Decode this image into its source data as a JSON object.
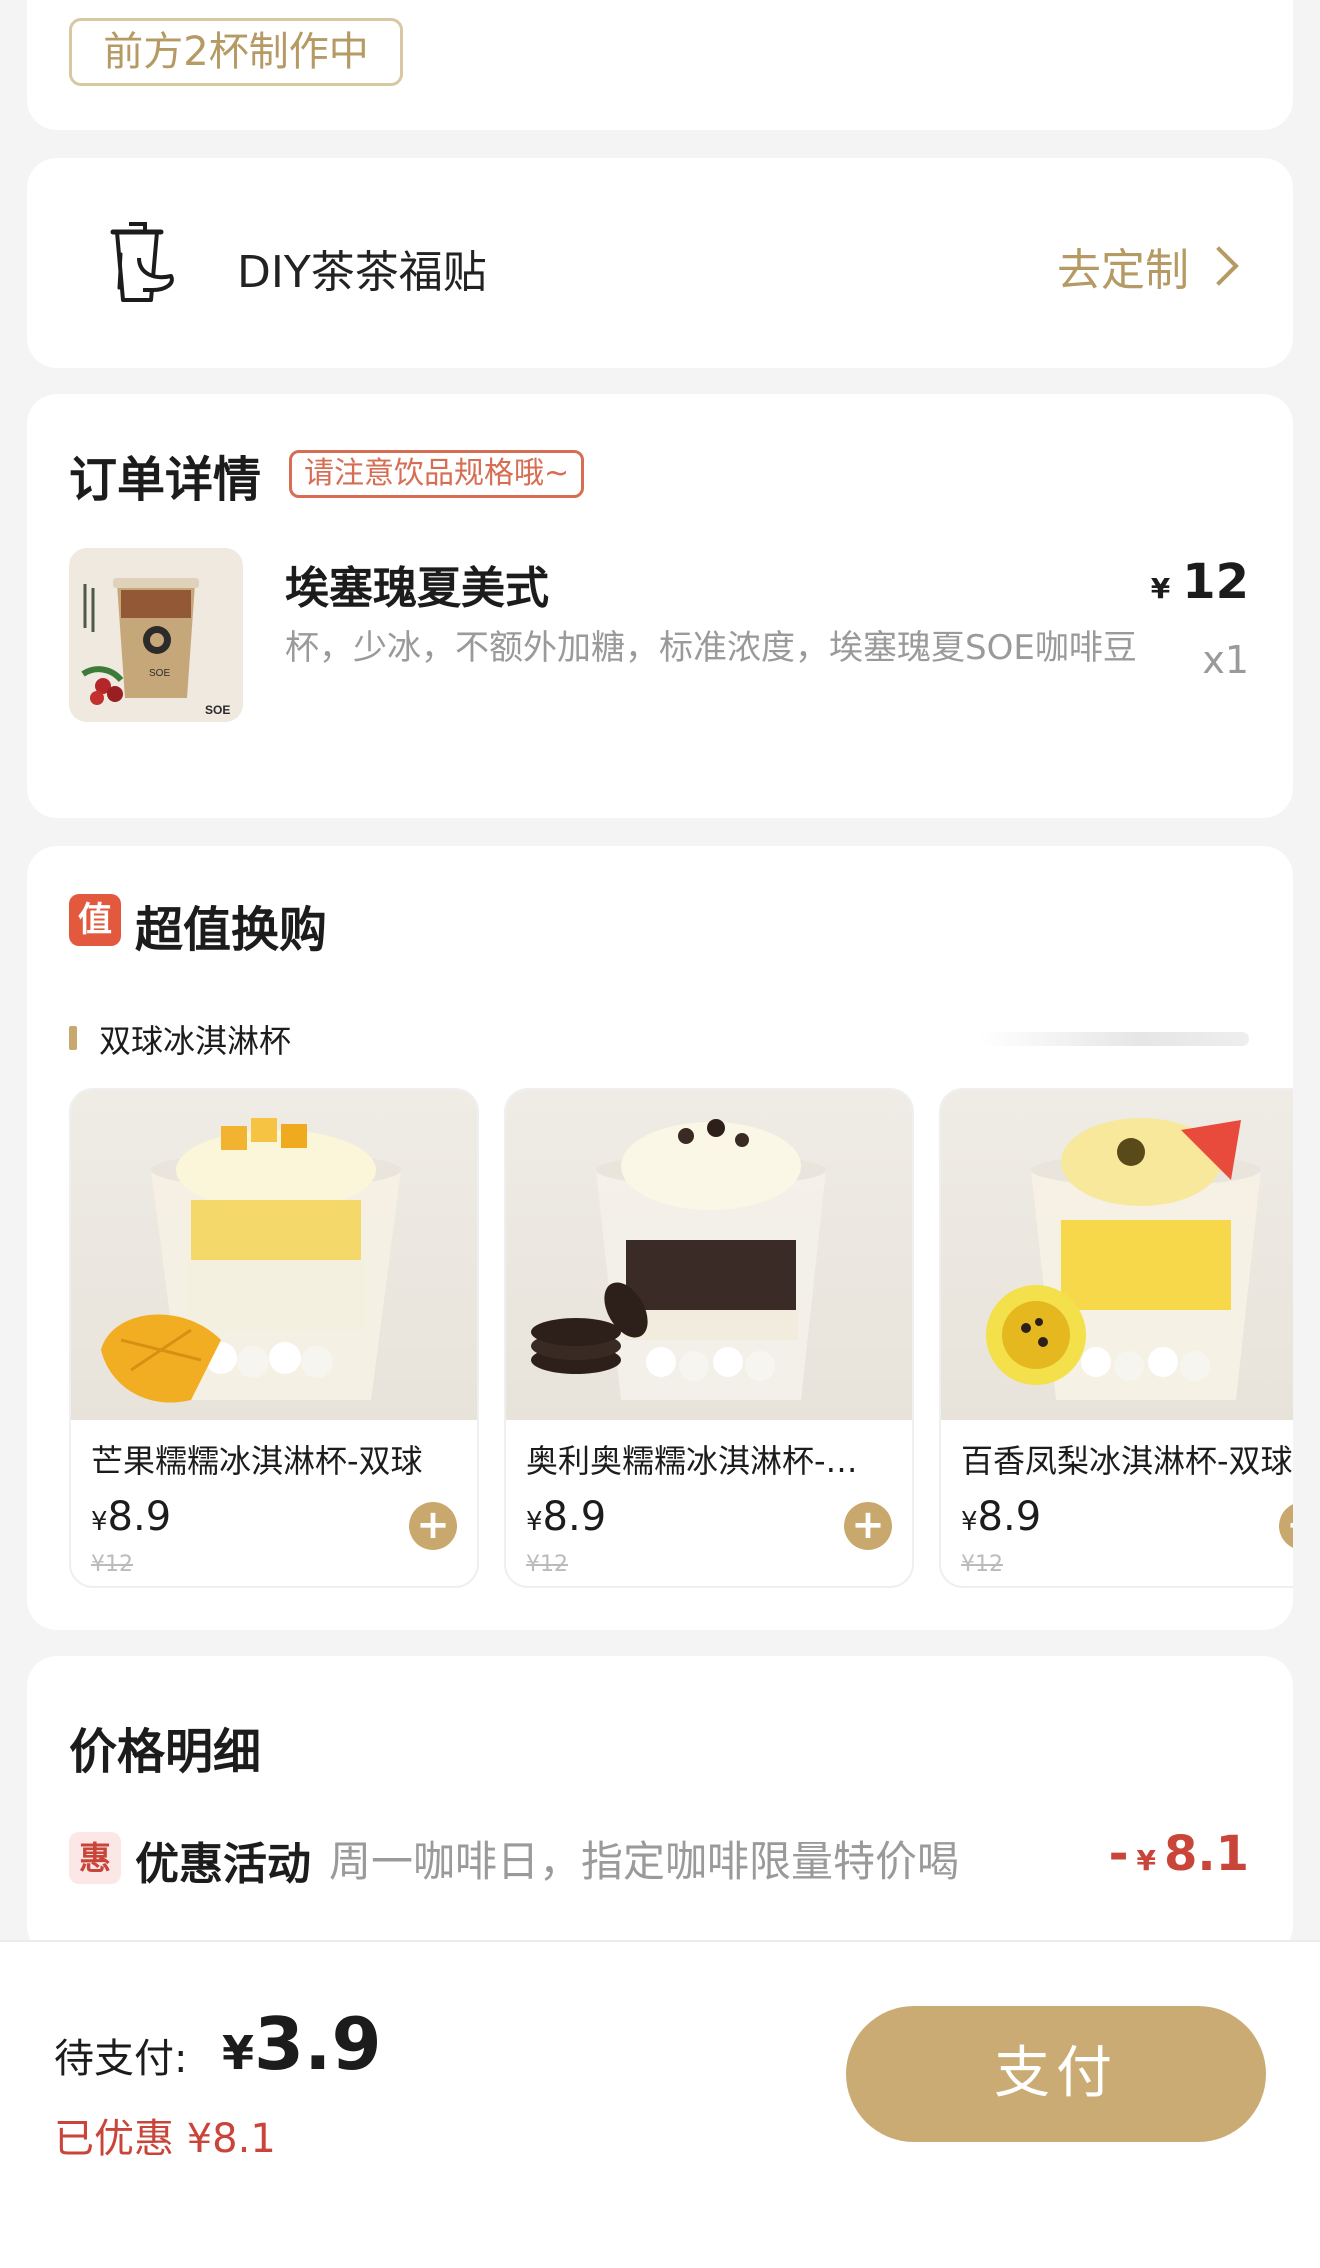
{
  "queue": {
    "status_text": "前方2杯制作中"
  },
  "diy": {
    "title": "DIY茶茶福贴",
    "cta_label": "去定制",
    "icon": "cup-sticker-icon"
  },
  "order": {
    "title": "订单详情",
    "notice": "请注意饮品规格哦~",
    "item": {
      "name": "埃塞瑰夏美式",
      "spec": "杯，少冰，不额外加糖，标准浓度，埃塞瑰夏SOE咖啡豆",
      "currency": "¥",
      "price": "12",
      "qty": "x1"
    }
  },
  "upsell": {
    "badge": "值",
    "title": "超值换购",
    "section_title": "双球冰淇淋杯",
    "products": [
      {
        "name": "芒果糯糯冰淇淋杯-双球",
        "currency": "¥",
        "price": "8.9",
        "original": "¥12"
      },
      {
        "name": "奥利奥糯糯冰淇淋杯-…",
        "currency": "¥",
        "price": "8.9",
        "original": "¥12"
      },
      {
        "name": "百香凤梨冰淇淋杯-双球",
        "currency": "¥",
        "price": "8.9",
        "original": "¥12"
      }
    ],
    "add_symbol": "+"
  },
  "price_detail": {
    "title": "价格明细",
    "promo_badge": "惠",
    "promo_name": "优惠活动",
    "promo_desc": "周一咖啡日，指定咖啡限量特价喝",
    "promo_sign": "-",
    "promo_currency": "¥",
    "promo_amount": "8.1"
  },
  "footer": {
    "due_label": "待支付:",
    "due_currency": "¥",
    "due_amount": "3.9",
    "saved_text": "已优惠 ¥8.1",
    "pay_label": "支付"
  },
  "colors": {
    "accent_gold": "#c9a86e",
    "discount_red": "#c9453a",
    "badge_orange": "#e3593e"
  }
}
